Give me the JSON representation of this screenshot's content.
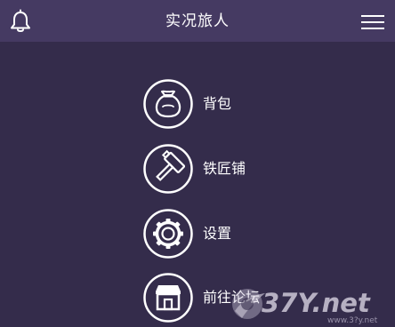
{
  "header": {
    "title": "实况旅人",
    "left_icon": "bell-icon",
    "right_icon": "hamburger-menu-icon"
  },
  "menu": {
    "items": [
      {
        "label": "背包",
        "icon": "bag-icon"
      },
      {
        "label": "铁匠铺",
        "icon": "hammer-icon"
      },
      {
        "label": "设置",
        "icon": "gear-icon"
      },
      {
        "label": "前往论坛",
        "icon": "shop-icon"
      }
    ]
  },
  "watermark": {
    "text": "37Y.net",
    "sub": "www.3?y.net"
  },
  "colors": {
    "background": "#342c4b",
    "header": "#453a62",
    "foreground": "#ffffff"
  }
}
